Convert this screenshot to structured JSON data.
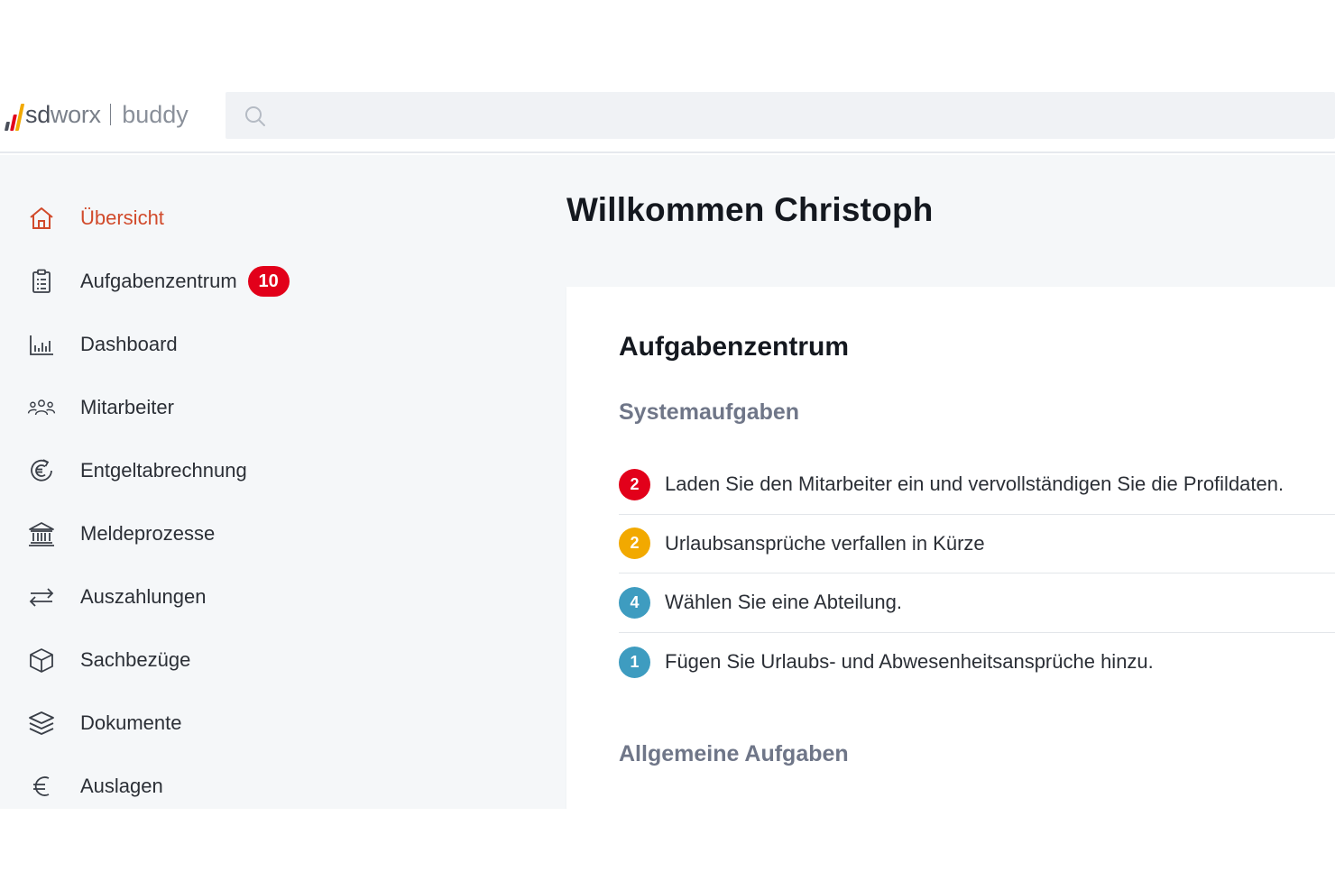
{
  "brand": {
    "name_sd": "sd",
    "name_worx": "worx",
    "product": "buddy",
    "colors": {
      "dark": "#4a4f5a",
      "red": "#e2001a",
      "yellow": "#f2a900"
    }
  },
  "search": {
    "placeholder": ""
  },
  "sidebar": {
    "items": [
      {
        "label": "Übersicht",
        "icon": "home-icon",
        "active": true
      },
      {
        "label": "Aufgabenzentrum",
        "icon": "clipboard-icon",
        "badge": "10"
      },
      {
        "label": "Dashboard",
        "icon": "bar-chart-icon"
      },
      {
        "label": "Mitarbeiter",
        "icon": "users-icon"
      },
      {
        "label": "Entgeltabrechnung",
        "icon": "euro-cycle-icon"
      },
      {
        "label": "Meldeprozesse",
        "icon": "government-building-icon"
      },
      {
        "label": "Auszahlungen",
        "icon": "transfer-arrows-icon"
      },
      {
        "label": "Sachbezüge",
        "icon": "box-icon"
      },
      {
        "label": "Dokumente",
        "icon": "layers-icon"
      },
      {
        "label": "Auslagen",
        "icon": "euro-icon"
      }
    ],
    "active_color": "#d14a2b",
    "badge_color": "#e2001a"
  },
  "main": {
    "welcome": "Willkommen Christoph",
    "card": {
      "title": "Aufgabenzentrum",
      "system_section": "Systemaufgaben",
      "general_section": "Allgemeine Aufgaben",
      "tasks": [
        {
          "count": "2",
          "color": "#e2001a",
          "text": "Laden Sie den Mitarbeiter ein und vervollständigen Sie die Profildaten."
        },
        {
          "count": "2",
          "color": "#f2a900",
          "text": "Urlaubsansprüche verfallen in Kürze"
        },
        {
          "count": "4",
          "color": "#3e9cc0",
          "text": "Wählen Sie eine Abteilung."
        },
        {
          "count": "1",
          "color": "#3e9cc0",
          "text": "Fügen Sie Urlaubs- und Abwesenheitsansprüche hinzu."
        }
      ]
    }
  }
}
